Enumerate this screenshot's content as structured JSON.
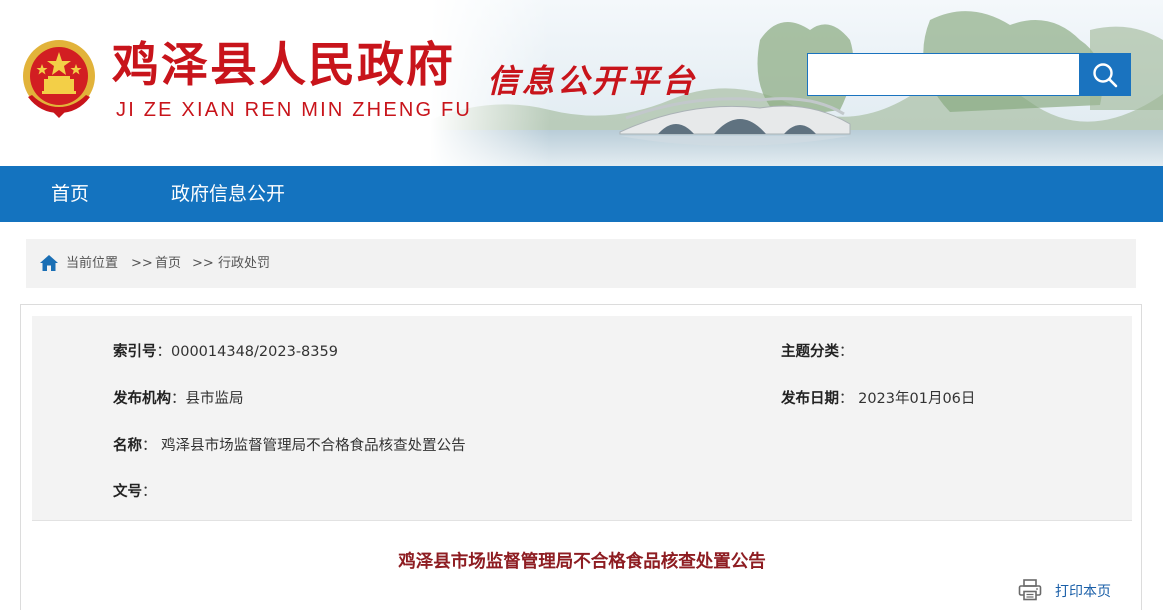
{
  "header": {
    "site_title": "鸡泽县人民政府",
    "site_pinyin": "JI ZE XIAN REN MIN ZHENG FU",
    "platform_name": "信息公开平台",
    "search": {
      "placeholder": "",
      "value": ""
    }
  },
  "nav": {
    "items": [
      {
        "label": "首页"
      },
      {
        "label": "政府信息公开"
      }
    ]
  },
  "breadcrumb": {
    "prefix": "当前位置",
    "separator": ">>",
    "items": [
      "首页",
      "行政处罚"
    ]
  },
  "meta": {
    "index_label": "索引号",
    "index_value": "000014348/2023-8359",
    "topic_label": "主题分类",
    "topic_value": "",
    "publisher_label": "发布机构",
    "publisher_value": "县市监局",
    "date_label": "发布日期",
    "date_value": "2023年01月06日",
    "name_label": "名称",
    "name_value": "鸡泽县市场监督管理局不合格食品核查处置公告",
    "doc_no_label": "文号",
    "doc_no_value": ""
  },
  "article": {
    "title": "鸡泽县市场监督管理局不合格食品核查处置公告",
    "print_label": "打印本页"
  },
  "colors": {
    "brand_red": "#c8141b",
    "nav_blue": "#1473bf",
    "title_red": "#8e1d22",
    "link_blue": "#1a5fa8"
  }
}
